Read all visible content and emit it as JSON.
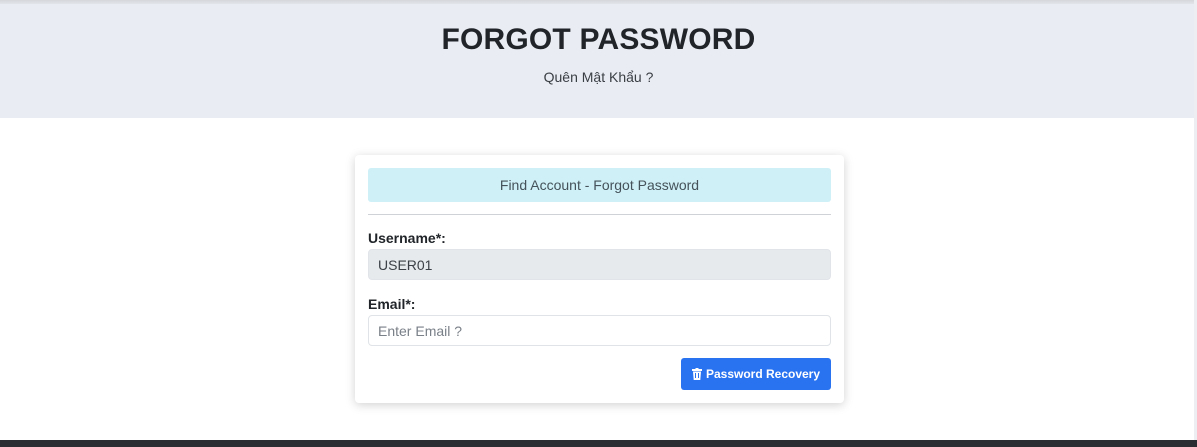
{
  "header": {
    "title": "FORGOT PASSWORD",
    "subtitle": "Quên Mật Khẩu ?"
  },
  "form": {
    "header_text": "Find Account - Forgot Password",
    "username_label": "Username*:",
    "username_value": "USER01",
    "email_label": "Email*:",
    "email_value": "",
    "email_placeholder": "Enter Email ?",
    "submit_label": "Password Recovery",
    "submit_icon": "trash-icon"
  },
  "colors": {
    "hero_background": "#e9ecf3",
    "card_header_background": "#cff0f7",
    "button_primary": "#2a73f0",
    "footer_background": "#2a2d31"
  }
}
